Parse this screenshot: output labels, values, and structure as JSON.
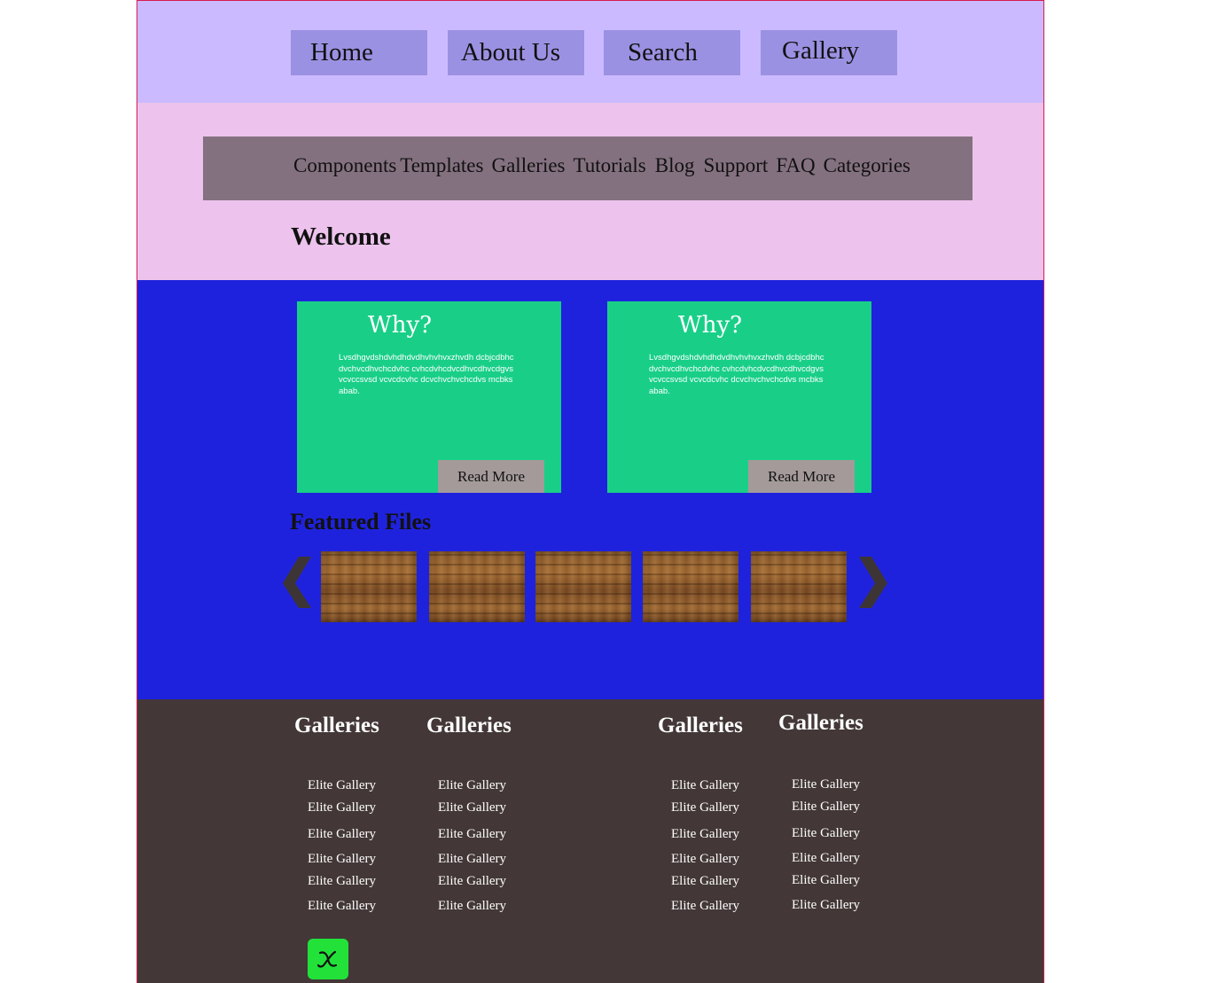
{
  "top_nav": {
    "items": [
      "Home",
      "About Us",
      "Search",
      "Gallery"
    ]
  },
  "sub_nav": {
    "items": [
      "Components",
      "Templates",
      "Galleries",
      "Tutorials",
      "Blog",
      "Support",
      "FAQ",
      "Categories"
    ]
  },
  "welcome": {
    "heading": "Welcome"
  },
  "cards": [
    {
      "title": "Why?",
      "body": "Lvsdhgvdshdvhdhdvdhvhvhvxzhvdh dcbjcdbhcdvchvcdhvchcdvhc cvhcdvhcdvcdhvcdhvcdgvsvcvccsvsd vcvcdcvhc dcvchvchvchcdvs mcbksabab.",
      "button": "Read More"
    },
    {
      "title": "Why?",
      "body": "Lvsdhgvdshdvhdhdvdhvhvhvxzhvdh dcbjcdbhcdvchvcdhvchcdvhc cvhcdvhcdvcdhvcdhvcdgvsvcvccsvsd vcvcdcvhc dcvchvchvchcdvs mcbksabab.",
      "button": "Read More"
    }
  ],
  "featured": {
    "heading": "Featured Files",
    "prev_icon": "chevron-left-icon",
    "next_icon": "chevron-right-icon",
    "thumbnails": [
      "wood-texture",
      "wood-texture",
      "wood-texture",
      "wood-texture",
      "wood-texture"
    ]
  },
  "footer": {
    "columns": [
      {
        "heading": "Galleries",
        "links": [
          "Elite Gallery",
          "Elite Gallery",
          "Elite Gallery",
          "Elite Gallery",
          "Elite Gallery",
          "Elite Gallery"
        ]
      },
      {
        "heading": "Galleries",
        "links": [
          "Elite Gallery",
          "Elite Gallery",
          "Elite Gallery",
          "Elite Gallery",
          "Elite Gallery",
          "Elite Gallery"
        ]
      },
      {
        "heading": "Galleries",
        "links": [
          "Elite Gallery",
          "Elite Gallery",
          "Elite Gallery",
          "Elite Gallery",
          "Elite Gallery",
          "Elite Gallery"
        ]
      },
      {
        "heading": "Galleries",
        "links": [
          "Elite Gallery",
          "Elite Gallery",
          "Elite Gallery",
          "Elite Gallery",
          "Elite Gallery",
          "Elite Gallery"
        ]
      }
    ],
    "badge_icon": "math-x-icon"
  },
  "colors": {
    "top_bar": "#cbbaff",
    "top_button": "#9b91e2",
    "pink_band": "#edc3ed",
    "sub_nav": "#847180",
    "blue_band": "#1f22dd",
    "card": "#19cf88",
    "read_more": "#a49a9a",
    "footer": "#433737",
    "badge": "#22e23a",
    "frame_border": "#d81b50"
  }
}
